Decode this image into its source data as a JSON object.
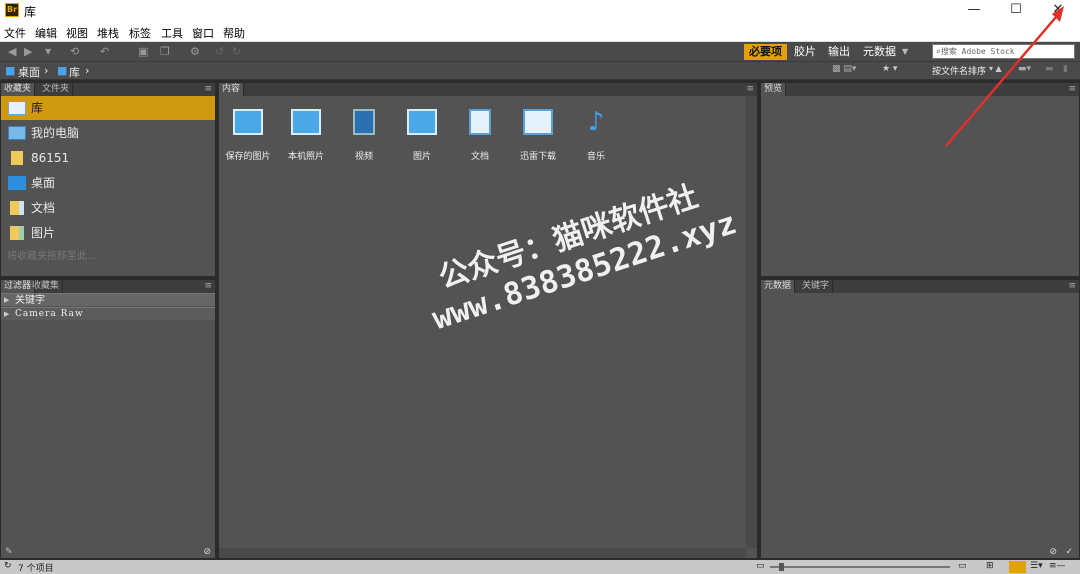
{
  "window": {
    "title": "库",
    "app_icon": "Br",
    "minimize": "—",
    "maximize": "☐",
    "close": "✕"
  },
  "menu": [
    "文件",
    "编辑",
    "视图",
    "堆栈",
    "标签",
    "工具",
    "窗口",
    "帮助"
  ],
  "toolbar": {
    "workspaces": [
      "必要项",
      "胶片",
      "输出",
      "元数据"
    ],
    "active_workspace": "必要项",
    "workspace_dropdown": "▼",
    "search_placeholder": "搜索 Adobe Stock",
    "sort_label": "按文件名排序"
  },
  "path": {
    "items": [
      "桌面",
      "库"
    ]
  },
  "favorites": {
    "tabs": [
      "收藏夹",
      "文件夹"
    ],
    "items": [
      {
        "label": "库",
        "selected": true,
        "icon": "library-icon"
      },
      {
        "label": "我的电脑",
        "selected": false,
        "icon": "computer-icon"
      },
      {
        "label": "86151",
        "selected": false,
        "icon": "user-folder-icon"
      },
      {
        "label": "桌面",
        "selected": false,
        "icon": "desktop-icon"
      },
      {
        "label": "文档",
        "selected": false,
        "icon": "documents-icon"
      },
      {
        "label": "图片",
        "selected": false,
        "icon": "pictures-icon"
      }
    ],
    "hint": "将收藏夹拖移至此..."
  },
  "filter": {
    "tabs": [
      "过滤器",
      "收藏集"
    ],
    "rows": [
      "关键字",
      "Camera Raw"
    ]
  },
  "content": {
    "tab": "内容",
    "items": [
      {
        "label": "保存的图片",
        "icon": "monitor-icon"
      },
      {
        "label": "本机照片",
        "icon": "monitor-icon"
      },
      {
        "label": "视频",
        "icon": "video-icon"
      },
      {
        "label": "图片",
        "icon": "monitor-icon"
      },
      {
        "label": "文档",
        "icon": "document-icon"
      },
      {
        "label": "迅雷下载",
        "icon": "download-icon"
      },
      {
        "label": "音乐",
        "icon": "music-icon"
      }
    ]
  },
  "preview": {
    "tab": "预览"
  },
  "metadata": {
    "tabs": [
      "元数据",
      "关键字"
    ]
  },
  "status": {
    "text": "7 个项目"
  },
  "watermark": {
    "line1": "公众号：猫咪软件社",
    "line2": "www.838385222.xyz"
  },
  "colors": {
    "accent": "#d09a10",
    "panel": "#535353",
    "background": "#2b2b2b",
    "arrow": "#e0302a"
  }
}
